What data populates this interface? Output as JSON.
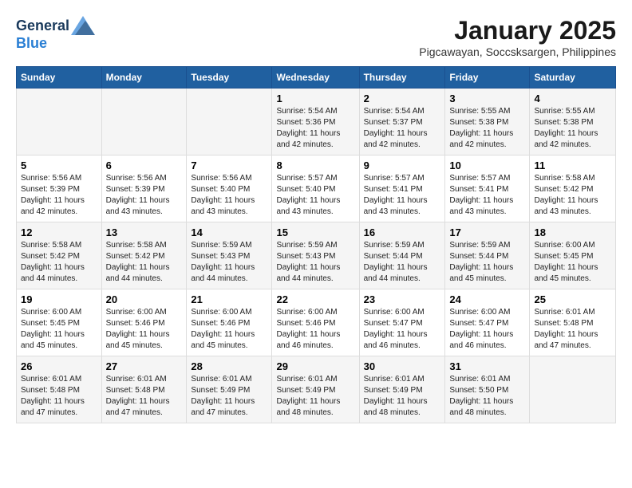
{
  "header": {
    "logo_general": "General",
    "logo_blue": "Blue",
    "month": "January 2025",
    "location": "Pigcawayan, Soccsksargen, Philippines"
  },
  "weekdays": [
    "Sunday",
    "Monday",
    "Tuesday",
    "Wednesday",
    "Thursday",
    "Friday",
    "Saturday"
  ],
  "weeks": [
    [
      {
        "day": "",
        "info": ""
      },
      {
        "day": "",
        "info": ""
      },
      {
        "day": "",
        "info": ""
      },
      {
        "day": "1",
        "info": "Sunrise: 5:54 AM\nSunset: 5:36 PM\nDaylight: 11 hours\nand 42 minutes."
      },
      {
        "day": "2",
        "info": "Sunrise: 5:54 AM\nSunset: 5:37 PM\nDaylight: 11 hours\nand 42 minutes."
      },
      {
        "day": "3",
        "info": "Sunrise: 5:55 AM\nSunset: 5:38 PM\nDaylight: 11 hours\nand 42 minutes."
      },
      {
        "day": "4",
        "info": "Sunrise: 5:55 AM\nSunset: 5:38 PM\nDaylight: 11 hours\nand 42 minutes."
      }
    ],
    [
      {
        "day": "5",
        "info": "Sunrise: 5:56 AM\nSunset: 5:39 PM\nDaylight: 11 hours\nand 42 minutes."
      },
      {
        "day": "6",
        "info": "Sunrise: 5:56 AM\nSunset: 5:39 PM\nDaylight: 11 hours\nand 43 minutes."
      },
      {
        "day": "7",
        "info": "Sunrise: 5:56 AM\nSunset: 5:40 PM\nDaylight: 11 hours\nand 43 minutes."
      },
      {
        "day": "8",
        "info": "Sunrise: 5:57 AM\nSunset: 5:40 PM\nDaylight: 11 hours\nand 43 minutes."
      },
      {
        "day": "9",
        "info": "Sunrise: 5:57 AM\nSunset: 5:41 PM\nDaylight: 11 hours\nand 43 minutes."
      },
      {
        "day": "10",
        "info": "Sunrise: 5:57 AM\nSunset: 5:41 PM\nDaylight: 11 hours\nand 43 minutes."
      },
      {
        "day": "11",
        "info": "Sunrise: 5:58 AM\nSunset: 5:42 PM\nDaylight: 11 hours\nand 43 minutes."
      }
    ],
    [
      {
        "day": "12",
        "info": "Sunrise: 5:58 AM\nSunset: 5:42 PM\nDaylight: 11 hours\nand 44 minutes."
      },
      {
        "day": "13",
        "info": "Sunrise: 5:58 AM\nSunset: 5:42 PM\nDaylight: 11 hours\nand 44 minutes."
      },
      {
        "day": "14",
        "info": "Sunrise: 5:59 AM\nSunset: 5:43 PM\nDaylight: 11 hours\nand 44 minutes."
      },
      {
        "day": "15",
        "info": "Sunrise: 5:59 AM\nSunset: 5:43 PM\nDaylight: 11 hours\nand 44 minutes."
      },
      {
        "day": "16",
        "info": "Sunrise: 5:59 AM\nSunset: 5:44 PM\nDaylight: 11 hours\nand 44 minutes."
      },
      {
        "day": "17",
        "info": "Sunrise: 5:59 AM\nSunset: 5:44 PM\nDaylight: 11 hours\nand 45 minutes."
      },
      {
        "day": "18",
        "info": "Sunrise: 6:00 AM\nSunset: 5:45 PM\nDaylight: 11 hours\nand 45 minutes."
      }
    ],
    [
      {
        "day": "19",
        "info": "Sunrise: 6:00 AM\nSunset: 5:45 PM\nDaylight: 11 hours\nand 45 minutes."
      },
      {
        "day": "20",
        "info": "Sunrise: 6:00 AM\nSunset: 5:46 PM\nDaylight: 11 hours\nand 45 minutes."
      },
      {
        "day": "21",
        "info": "Sunrise: 6:00 AM\nSunset: 5:46 PM\nDaylight: 11 hours\nand 45 minutes."
      },
      {
        "day": "22",
        "info": "Sunrise: 6:00 AM\nSunset: 5:46 PM\nDaylight: 11 hours\nand 46 minutes."
      },
      {
        "day": "23",
        "info": "Sunrise: 6:00 AM\nSunset: 5:47 PM\nDaylight: 11 hours\nand 46 minutes."
      },
      {
        "day": "24",
        "info": "Sunrise: 6:00 AM\nSunset: 5:47 PM\nDaylight: 11 hours\nand 46 minutes."
      },
      {
        "day": "25",
        "info": "Sunrise: 6:01 AM\nSunset: 5:48 PM\nDaylight: 11 hours\nand 47 minutes."
      }
    ],
    [
      {
        "day": "26",
        "info": "Sunrise: 6:01 AM\nSunset: 5:48 PM\nDaylight: 11 hours\nand 47 minutes."
      },
      {
        "day": "27",
        "info": "Sunrise: 6:01 AM\nSunset: 5:48 PM\nDaylight: 11 hours\nand 47 minutes."
      },
      {
        "day": "28",
        "info": "Sunrise: 6:01 AM\nSunset: 5:49 PM\nDaylight: 11 hours\nand 47 minutes."
      },
      {
        "day": "29",
        "info": "Sunrise: 6:01 AM\nSunset: 5:49 PM\nDaylight: 11 hours\nand 48 minutes."
      },
      {
        "day": "30",
        "info": "Sunrise: 6:01 AM\nSunset: 5:49 PM\nDaylight: 11 hours\nand 48 minutes."
      },
      {
        "day": "31",
        "info": "Sunrise: 6:01 AM\nSunset: 5:50 PM\nDaylight: 11 hours\nand 48 minutes."
      },
      {
        "day": "",
        "info": ""
      }
    ]
  ]
}
